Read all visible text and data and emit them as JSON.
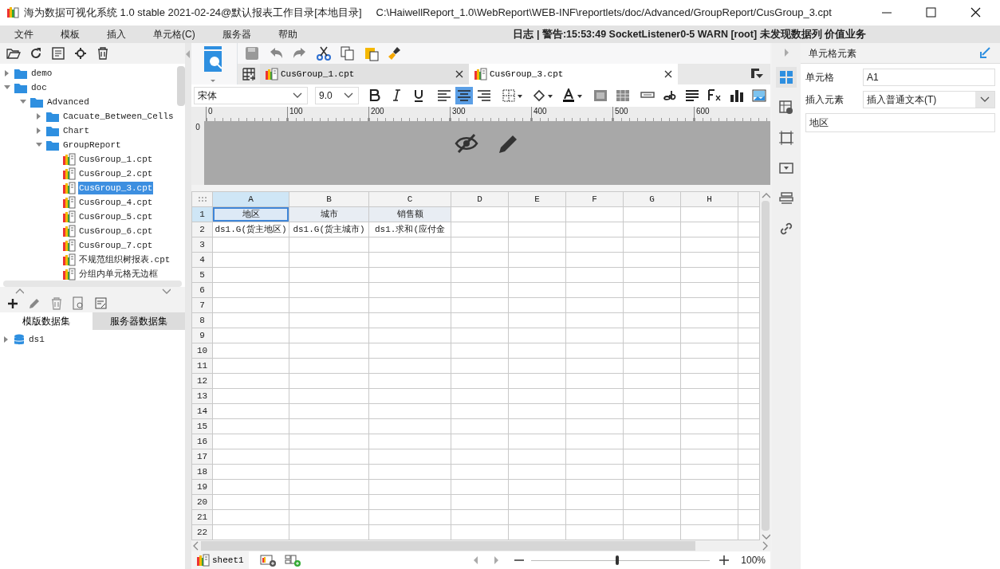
{
  "window": {
    "title": "海为数据可视化系统 1.0 stable 2021-02-24@默认报表工作目录[本地目录]",
    "path": "C:\\HaiwellReport_1.0\\WebReport\\WEB-INF\\reportlets/doc/Advanced/GroupReport/CusGroup_3.cpt"
  },
  "menu": [
    "文件",
    "模板",
    "插入",
    "单元格(C)",
    "服务器",
    "帮助"
  ],
  "log": "日志 | 警告:15:53:49 SocketListener0-5 WARN [root] 未发现数据列 价值业务",
  "tree": [
    {
      "label": "demo",
      "kind": "folder",
      "expanded": false
    },
    {
      "label": "doc",
      "kind": "folder",
      "expanded": true,
      "children": [
        {
          "label": "Advanced",
          "kind": "folder",
          "expanded": true,
          "children": [
            {
              "label": "Cacuate_Between_Cells",
              "kind": "folder",
              "expanded": false
            },
            {
              "label": "Chart",
              "kind": "folder",
              "expanded": false
            },
            {
              "label": "GroupReport",
              "kind": "folder",
              "expanded": true,
              "children": [
                {
                  "label": "CusGroup_1.cpt",
                  "kind": "file",
                  "selected": false
                },
                {
                  "label": "CusGroup_2.cpt",
                  "kind": "file",
                  "selected": false
                },
                {
                  "label": "CusGroup_3.cpt",
                  "kind": "file",
                  "selected": true
                },
                {
                  "label": "CusGroup_4.cpt",
                  "kind": "file",
                  "selected": false
                },
                {
                  "label": "CusGroup_5.cpt",
                  "kind": "file",
                  "selected": false
                },
                {
                  "label": "CusGroup_6.cpt",
                  "kind": "file",
                  "selected": false
                },
                {
                  "label": "CusGroup_7.cpt",
                  "kind": "file",
                  "selected": false
                },
                {
                  "label": "不规范组织树报表.cpt",
                  "kind": "file",
                  "selected": false
                },
                {
                  "label": "分组内单元格无边框",
                  "kind": "file",
                  "selected": false
                }
              ]
            }
          ]
        }
      ]
    }
  ],
  "dataset_tabs": [
    {
      "label": "模版数据集",
      "selected": true
    },
    {
      "label": "服务器数据集",
      "selected": false
    }
  ],
  "datasets": [
    {
      "label": "ds1",
      "expanded": false
    }
  ],
  "doc_tabs": [
    {
      "label": "CusGroup_1.cpt",
      "selected": false
    },
    {
      "label": "CusGroup_3.cpt",
      "selected": true
    }
  ],
  "font": {
    "family": "宋体",
    "size": "9.0"
  },
  "align_buttons": [
    {
      "kind": "left",
      "selected": false
    },
    {
      "kind": "center",
      "selected": true
    },
    {
      "kind": "right",
      "selected": false
    }
  ],
  "ruler": {
    "ticks": [
      "0",
      "100",
      "200",
      "300",
      "400",
      "500",
      "600"
    ],
    "vertical": "0"
  },
  "grid": {
    "columns": [
      {
        "label": "A",
        "selected": true
      },
      {
        "label": "B",
        "selected": false
      },
      {
        "label": "C",
        "selected": false
      },
      {
        "label": "D",
        "selected": false
      },
      {
        "label": "E",
        "selected": false
      },
      {
        "label": "F",
        "selected": false
      },
      {
        "label": "G",
        "selected": false
      },
      {
        "label": "H",
        "selected": false
      }
    ],
    "rows": [
      {
        "label": "1",
        "selected": true
      },
      {
        "label": "2",
        "selected": false
      },
      {
        "label": "3",
        "selected": false
      },
      {
        "label": "4",
        "selected": false
      },
      {
        "label": "5",
        "selected": false
      },
      {
        "label": "6",
        "selected": false
      },
      {
        "label": "7",
        "selected": false
      },
      {
        "label": "8",
        "selected": false
      },
      {
        "label": "9",
        "selected": false
      },
      {
        "label": "10",
        "selected": false
      },
      {
        "label": "11",
        "selected": false
      },
      {
        "label": "12",
        "selected": false
      },
      {
        "label": "13",
        "selected": false
      },
      {
        "label": "14",
        "selected": false
      },
      {
        "label": "15",
        "selected": false
      },
      {
        "label": "16",
        "selected": false
      },
      {
        "label": "17",
        "selected": false
      },
      {
        "label": "18",
        "selected": false
      },
      {
        "label": "19",
        "selected": false
      },
      {
        "label": "20",
        "selected": false
      },
      {
        "label": "21",
        "selected": false
      },
      {
        "label": "22",
        "selected": false
      }
    ],
    "cells": [
      [
        {
          "text": "地区",
          "selected": true,
          "shaded": true
        },
        {
          "text": "城市",
          "selected": false,
          "shaded": true
        },
        {
          "text": "销售额",
          "selected": false,
          "shaded": true
        }
      ],
      [
        {
          "text": "ds1.G(货主地区)",
          "selected": false,
          "shaded": false
        },
        {
          "text": "ds1.G(货主城市)",
          "selected": false,
          "shaded": false
        },
        {
          "text": "ds1.求和(应付金",
          "selected": false,
          "shaded": false
        }
      ]
    ]
  },
  "sheet_tabs": [
    {
      "label": "sheet1",
      "selected": true
    }
  ],
  "zoom": {
    "level": 0.48,
    "reading": "100%"
  },
  "side_tools": [
    {
      "selected": true
    },
    {
      "selected": false
    },
    {
      "selected": false
    },
    {
      "selected": false
    },
    {
      "selected": false
    },
    {
      "selected": false
    }
  ],
  "panel": {
    "title": "单元格元素",
    "fields": [
      {
        "label": "单元格",
        "value": "A1",
        "kind": "text"
      },
      {
        "label": "插入元素",
        "value": "插入普通文本(T)",
        "kind": "select"
      }
    ],
    "content": "地区"
  }
}
